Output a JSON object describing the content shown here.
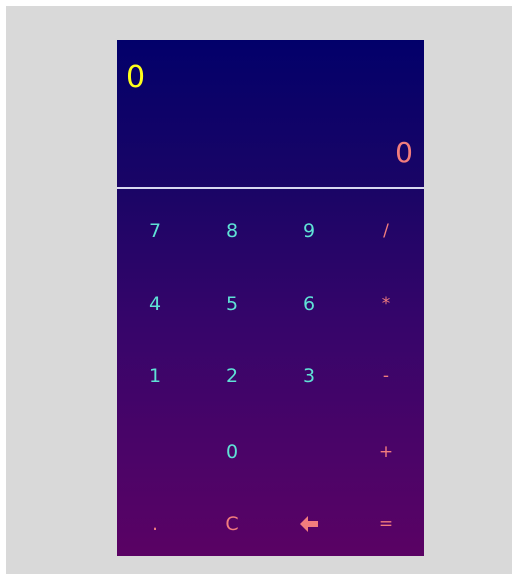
{
  "display": {
    "expression": "0",
    "result": "0"
  },
  "keys": {
    "seven": "7",
    "eight": "8",
    "nine": "9",
    "divide": "/",
    "four": "4",
    "five": "5",
    "six": "6",
    "multiply": "*",
    "one": "1",
    "two": "2",
    "three": "3",
    "subtract": "-",
    "zero": "0",
    "add": "+",
    "decimal": ".",
    "clear": "C",
    "backspace_icon": "arrow-left-icon",
    "equals": "="
  },
  "colors": {
    "gradient_top": "#02006a",
    "gradient_bottom": "#5a0264",
    "expression": "#ffff1a",
    "result": "#f27d7d",
    "digit": "#5fe2d6",
    "operator": "#f27d7d",
    "backdrop": "#d9d9d9"
  }
}
